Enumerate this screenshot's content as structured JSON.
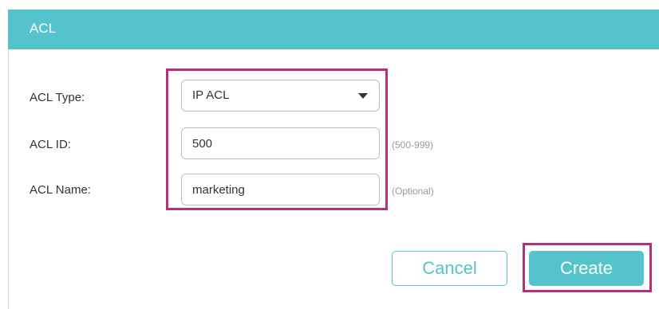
{
  "header": {
    "title": "ACL"
  },
  "form": {
    "acl_type": {
      "label": "ACL Type:",
      "value": "IP ACL"
    },
    "acl_id": {
      "label": "ACL ID:",
      "value": "500",
      "hint": "(500-999)"
    },
    "acl_name": {
      "label": "ACL Name:",
      "value": "marketing",
      "hint": "(Optional)"
    }
  },
  "actions": {
    "cancel_label": "Cancel",
    "create_label": "Create"
  },
  "colors": {
    "accent": "#55c3cc",
    "highlight": "#b8307c"
  }
}
